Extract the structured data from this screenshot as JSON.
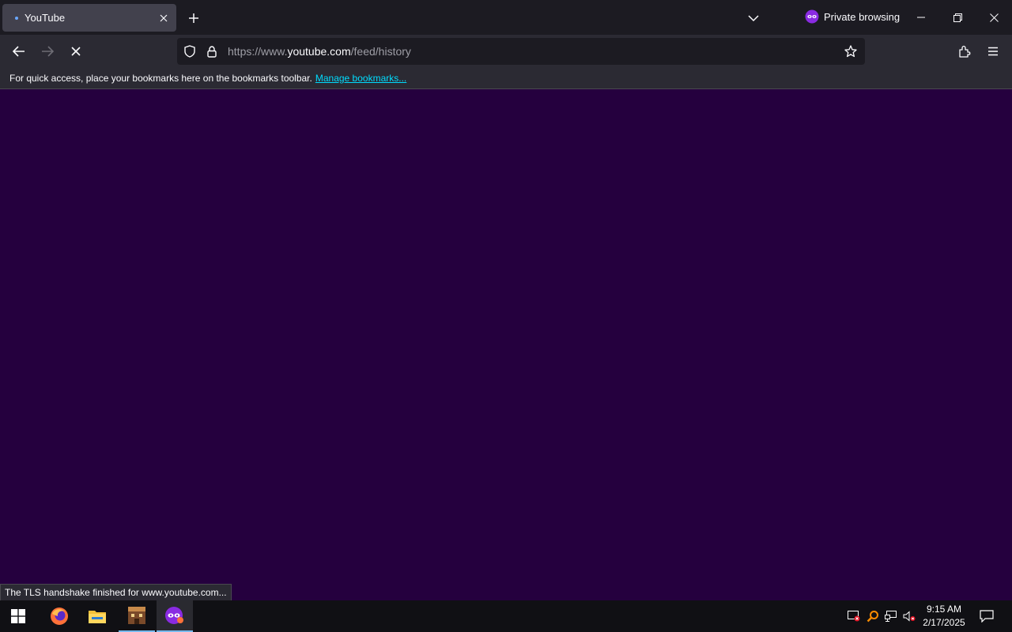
{
  "tab": {
    "title": "YouTube",
    "loading_dot_color": "#6aa7ff"
  },
  "window": {
    "private_label": "Private browsing"
  },
  "address": {
    "prefix": "https://www.",
    "host": "youtube.com",
    "path": "/feed/history"
  },
  "bookmarks": {
    "message": "For quick access, place your bookmarks here on the bookmarks toolbar.",
    "manage_link": "Manage bookmarks..."
  },
  "status": {
    "text": "The TLS handshake finished for www.youtube.com..."
  },
  "clock": {
    "time": "9:15 AM",
    "date": "2/17/2025"
  },
  "colors": {
    "page_bg": "#25003e",
    "link": "#00ddff",
    "chrome_dark": "#1c1b22",
    "chrome": "#2b2a33"
  },
  "taskbar": {
    "apps": [
      "start-icon",
      "firefox-icon",
      "file-explorer-icon",
      "app-icon",
      "private-browsing-icon"
    ]
  }
}
